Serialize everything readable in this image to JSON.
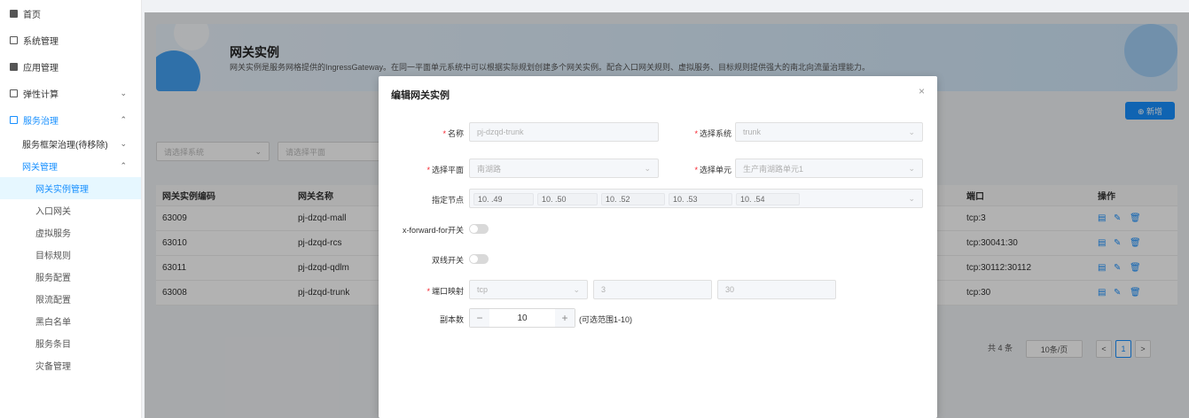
{
  "sidebar": {
    "items": [
      {
        "label": "首页"
      },
      {
        "label": "系统管理"
      },
      {
        "label": "应用管理"
      },
      {
        "label": "弹性计算",
        "arrow": "⌄"
      },
      {
        "label": "服务治理",
        "arrow": "⌃"
      },
      {
        "label": "服务框架治理(待移除)",
        "arrow": "⌄"
      },
      {
        "label": "网关管理",
        "arrow": "⌃"
      },
      {
        "label": "网关实例管理"
      },
      {
        "label": "入口网关"
      },
      {
        "label": "虚拟服务"
      },
      {
        "label": "目标规则"
      },
      {
        "label": "服务配置"
      },
      {
        "label": "限流配置"
      },
      {
        "label": "黑白名单"
      },
      {
        "label": "服务条目"
      },
      {
        "label": "灾备管理"
      }
    ]
  },
  "banner": {
    "title": "网关实例",
    "desc": "网关实例是服务网格提供的IngressGateway。在同一平面单元系统中可以根据实际规划创建多个网关实例。配合入口网关规则、虚拟服务、目标规则提供强大的南北向流量治理能力。"
  },
  "toolbar": {
    "new_label": "⊕ 新增"
  },
  "filters": {
    "system_placeholder": "请选择系统",
    "plane_placeholder": "请选择平面"
  },
  "table": {
    "headers": {
      "code": "网关实例编码",
      "name": "网关名称",
      "port": "端口",
      "ops": "操作"
    },
    "rows": [
      {
        "code": "63009",
        "name": "pj-dzqd-mall",
        "port": "tcp:3"
      },
      {
        "code": "63010",
        "name": "pj-dzqd-rcs",
        "port": "tcp:30041:30"
      },
      {
        "code": "63011",
        "name": "pj-dzqd-qdlm",
        "port": "tcp:30112:30112"
      },
      {
        "code": "63008",
        "name": "pj-dzqd-trunk",
        "port": "tcp:30"
      }
    ]
  },
  "pagination": {
    "total": "共 4 条",
    "page_size": "10条/页",
    "current": "1",
    "prev": "<",
    "next": ">"
  },
  "modal": {
    "title": "编辑网关实例",
    "close": "×",
    "name_label": "名称",
    "name_value": "pj-dzqd-trunk",
    "system_label": "选择系统",
    "system_value": "trunk",
    "plane_label": "选择平面",
    "plane_value": "南湖路",
    "unit_label": "选择单元",
    "unit_value": "生产南湖路单元1",
    "nodes_label": "指定节点",
    "nodes": [
      "10.  .49",
      "10.  .50",
      "10.  .52",
      "10.  .53",
      "10.  .54"
    ],
    "xff_label": "x-forward-for开关",
    "dual_label": "双线开关",
    "port_label": "端口映射",
    "port_protocol": "tcp",
    "port_in": "3",
    "port_out": "30",
    "replica_label": "副本数",
    "replica_value": "10",
    "replica_minus": "−",
    "replica_plus": "+",
    "replica_hint": "(可选范围1-10)"
  }
}
